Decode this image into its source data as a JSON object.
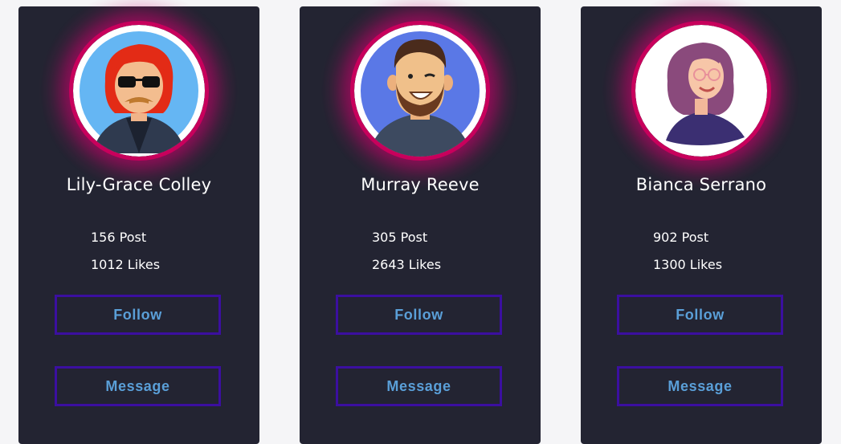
{
  "profiles": [
    {
      "name": "Lily-Grace Colley",
      "posts": "156 Post",
      "likes": "1012 Likes",
      "follow_label": "Follow",
      "message_label": "Message",
      "avatar_icon": "man-red-hair-sunglasses-avatar"
    },
    {
      "name": "Murray Reeve",
      "posts": "305 Post",
      "likes": "2643 Likes",
      "follow_label": "Follow",
      "message_label": "Message",
      "avatar_icon": "bearded-man-winking-avatar"
    },
    {
      "name": "Bianca Serrano",
      "posts": "902 Post",
      "likes": "1300 Likes",
      "follow_label": "Follow",
      "message_label": "Message",
      "avatar_icon": "woman-glasses-avatar"
    }
  ],
  "colors": {
    "page_background": "#f5f5f7",
    "card_background": "#232432",
    "glow": "#c8005c",
    "button_border": "#3b0fa0",
    "button_text": "#5a9fd8",
    "text": "#ffffff"
  }
}
